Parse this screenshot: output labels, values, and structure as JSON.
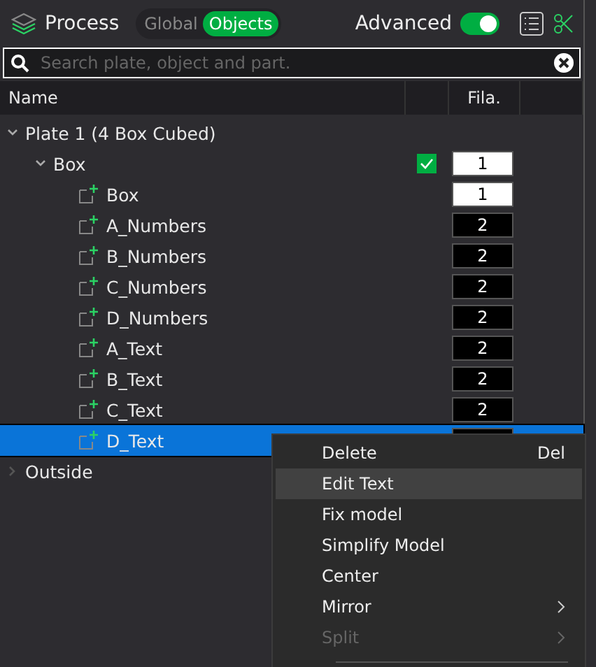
{
  "header": {
    "title": "Process",
    "modes": [
      {
        "label": "Global",
        "selected": false
      },
      {
        "label": "Objects",
        "selected": true
      }
    ],
    "advanced": {
      "label": "Advanced",
      "on": true
    }
  },
  "search": {
    "placeholder": "Search plate, object and part."
  },
  "table": {
    "columns": [
      "Name",
      "",
      "Fila."
    ],
    "rows": [
      {
        "kind": "plate",
        "label": "Plate 1 (4 Box Cubed)",
        "expanded": true,
        "children": [
          {
            "kind": "object",
            "label": "Box",
            "expanded": true,
            "checked": true,
            "fila": "1",
            "color": "#ffffff",
            "selected": false,
            "children": [
              {
                "kind": "part",
                "label": "Box",
                "fila": "1",
                "color": "#ffffff",
                "selected": false
              },
              {
                "kind": "part",
                "label": "A_Numbers",
                "fila": "2",
                "color": "#000000",
                "selected": false
              },
              {
                "kind": "part",
                "label": "B_Numbers",
                "fila": "2",
                "color": "#000000",
                "selected": false
              },
              {
                "kind": "part",
                "label": "C_Numbers",
                "fila": "2",
                "color": "#000000",
                "selected": false
              },
              {
                "kind": "part",
                "label": "D_Numbers",
                "fila": "2",
                "color": "#000000",
                "selected": false
              },
              {
                "kind": "part",
                "label": "A_Text",
                "fila": "2",
                "color": "#000000",
                "selected": false
              },
              {
                "kind": "part",
                "label": "B_Text",
                "fila": "2",
                "color": "#000000",
                "selected": false
              },
              {
                "kind": "part",
                "label": "C_Text",
                "fila": "2",
                "color": "#000000",
                "selected": false
              },
              {
                "kind": "part",
                "label": "D_Text",
                "color": "#000000",
                "selected": true
              }
            ]
          }
        ]
      },
      {
        "kind": "plate",
        "label": "Outside",
        "expanded": false
      }
    ]
  },
  "context_menu": [
    {
      "label": "Delete",
      "shortcut": "Del",
      "hovered": false,
      "disabled": false,
      "submenu": false
    },
    {
      "label": "Edit Text",
      "hovered": true,
      "disabled": false,
      "submenu": false
    },
    {
      "label": "Fix model",
      "hovered": false,
      "disabled": false,
      "submenu": false
    },
    {
      "label": "Simplify Model",
      "hovered": false,
      "disabled": false,
      "submenu": false
    },
    {
      "label": "Center",
      "hovered": false,
      "disabled": false,
      "submenu": false
    },
    {
      "label": "Mirror",
      "hovered": false,
      "disabled": false,
      "submenu": true
    },
    {
      "label": "Split",
      "hovered": false,
      "disabled": true,
      "submenu": true
    }
  ]
}
